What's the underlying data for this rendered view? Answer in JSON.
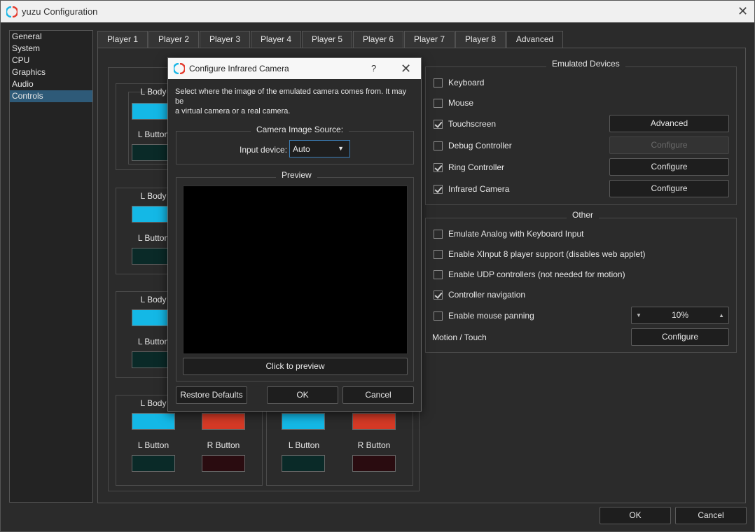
{
  "window": {
    "title": "yuzu Configuration"
  },
  "sidebar": {
    "items": [
      {
        "label": "General"
      },
      {
        "label": "System"
      },
      {
        "label": "CPU"
      },
      {
        "label": "Graphics"
      },
      {
        "label": "Audio"
      },
      {
        "label": "Controls"
      }
    ],
    "selected": "Controls"
  },
  "tabs": [
    {
      "label": "Player 1"
    },
    {
      "label": "Player 2"
    },
    {
      "label": "Player 3"
    },
    {
      "label": "Player 4"
    },
    {
      "label": "Player 5"
    },
    {
      "label": "Player 6"
    },
    {
      "label": "Player 7"
    },
    {
      "label": "Player 8"
    },
    {
      "label": "Advanced"
    }
  ],
  "active_tab": "Advanced",
  "colors": {
    "l_body": "#14b8e6",
    "l_button": "#0a2a28",
    "r_body": "#d63a26",
    "r_button": "#2a0c10"
  },
  "joycon_labels": {
    "l_body": "L Body",
    "l_button": "L Button",
    "r_button": "R Button"
  },
  "emulated_devices": {
    "title": "Emulated Devices",
    "items": [
      {
        "label": "Keyboard",
        "checked": false
      },
      {
        "label": "Mouse",
        "checked": false
      },
      {
        "label": "Touchscreen",
        "checked": true,
        "button": "Advanced"
      },
      {
        "label": "Debug Controller",
        "checked": false,
        "button": "Configure",
        "button_disabled": true
      },
      {
        "label": "Ring Controller",
        "checked": true,
        "button": "Configure"
      },
      {
        "label": "Infrared Camera",
        "checked": true,
        "button": "Configure"
      }
    ]
  },
  "other": {
    "title": "Other",
    "items": [
      {
        "label": "Emulate Analog with Keyboard Input",
        "checked": false
      },
      {
        "label": "Enable XInput 8 player support (disables web applet)",
        "checked": false
      },
      {
        "label": "Enable UDP controllers (not needed for motion)",
        "checked": false
      },
      {
        "label": "Controller navigation",
        "checked": true
      },
      {
        "label": "Enable mouse panning",
        "checked": false
      }
    ],
    "mouse_panning_value": "10%",
    "motion_touch_label": "Motion / Touch",
    "motion_touch_button": "Configure"
  },
  "footer": {
    "ok": "OK",
    "cancel": "Cancel"
  },
  "dialog": {
    "title": "Configure Infrared Camera",
    "help": "?",
    "description_line1": "Select where the image of the emulated camera comes from. It may be",
    "description_line2": "a virtual camera or a real camera.",
    "source_group_title": "Camera Image Source:",
    "input_device_label": "Input device:",
    "input_device_value": "Auto",
    "preview_group_title": "Preview",
    "preview_button": "Click to preview",
    "restore_defaults": "Restore Defaults",
    "ok": "OK",
    "cancel": "Cancel"
  }
}
